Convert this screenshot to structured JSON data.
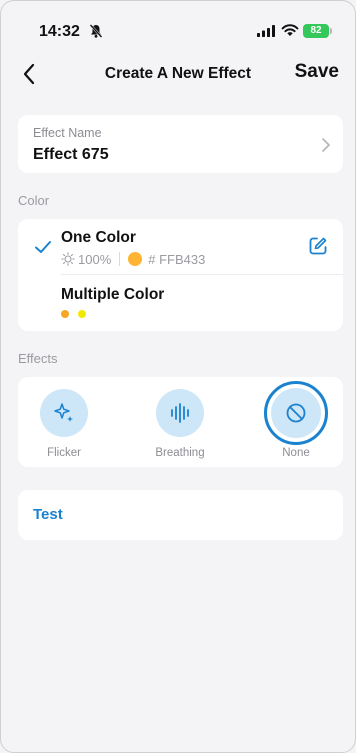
{
  "status_bar": {
    "time": "14:32",
    "battery": "82"
  },
  "nav": {
    "title": "Create A New Effect",
    "save_label": "Save"
  },
  "effect_name": {
    "label": "Effect Name",
    "value": "Effect 675"
  },
  "color_section": {
    "label": "Color",
    "options": [
      {
        "title": "One Color",
        "selected": true,
        "brightness": "100%",
        "hex": "# FFB433",
        "swatch_color": "#FFB433"
      },
      {
        "title": "Multiple Color",
        "selected": false,
        "dots": [
          "#F5A623",
          "#F2E800"
        ]
      }
    ]
  },
  "effects_section": {
    "label": "Effects",
    "items": [
      {
        "label": "Flicker",
        "icon": "sparkle-icon",
        "selected": false
      },
      {
        "label": "Breathing",
        "icon": "waveform-icon",
        "selected": false
      },
      {
        "label": "None",
        "icon": "prohibited-icon",
        "selected": true
      }
    ]
  },
  "test": {
    "label": "Test"
  },
  "colors": {
    "accent": "#1A82CF",
    "effect_bg": "#CDE6F8",
    "battery": "#34C759"
  }
}
